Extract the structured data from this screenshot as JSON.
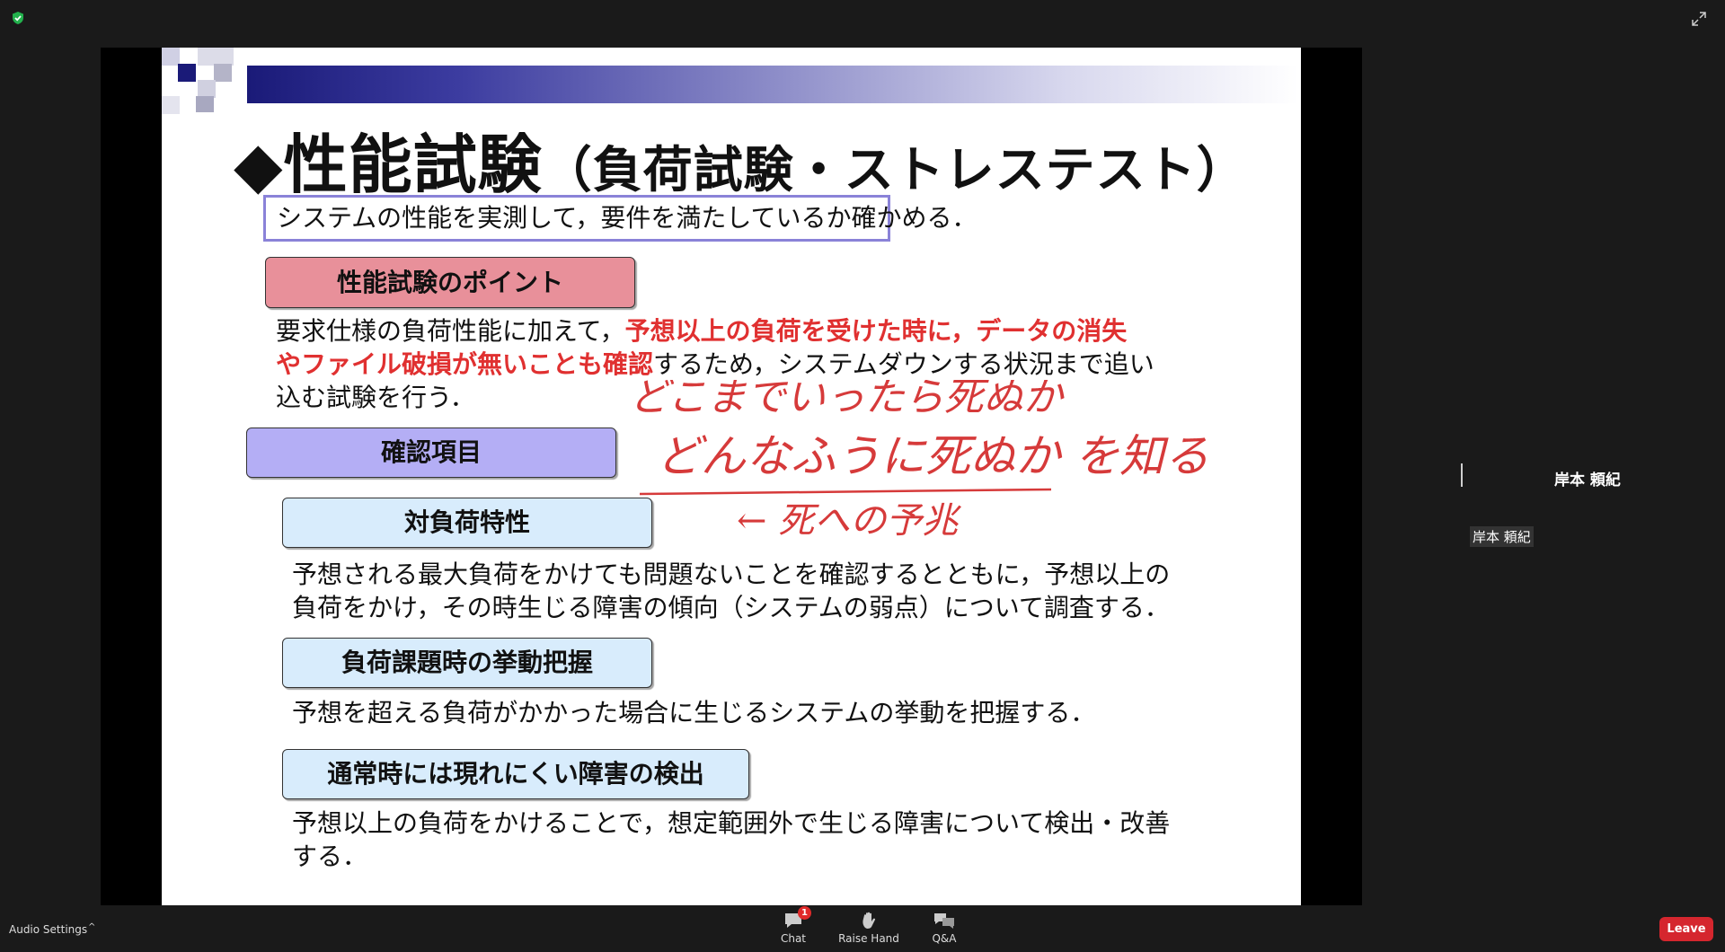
{
  "slide": {
    "title_main": "◆性能試験",
    "title_sub": "（負荷試験・ストレステスト）",
    "summary": "システムの性能を実測して，要件を満たしているか確かめる．",
    "point_heading": "性能試験のポイント",
    "point_text": {
      "line1_black": "要求仕様の負荷性能に加えて，",
      "line1_red": "予想以上の負荷を受けた時に，データの消失",
      "line2_red": "やファイル破損が無いことも確認",
      "line2_black": "するため，システムダウンする状況まで追い",
      "line3_black": "込む試験を行う．"
    },
    "check_heading": "確認項目",
    "items": [
      {
        "label": "対負荷特性",
        "line1": "予想される最大負荷をかけても問題ないことを確認するとともに，予想以上の",
        "line2": "負荷をかけ，その時生じる障害の傾向（システムの弱点）について調査する．"
      },
      {
        "label": "負荷課題時の挙動把握",
        "line1": "予想を超える負荷がかかった場合に生じるシステムの挙動を把握する．",
        "line2": ""
      },
      {
        "label": "通常時には現れにくい障害の検出",
        "line1": "予想以上の負荷をかけることで，想定範囲外で生じる障害について検出・改善",
        "line2": "する．"
      }
    ],
    "handwriting": {
      "line1": "どこまでいったら死ぬか",
      "line2": "どんなふうに死ぬか を知る",
      "line3": "← 死への予兆"
    }
  },
  "participant": {
    "name": "岸本 頼紀",
    "tag": "岸本 頼紀"
  },
  "controls": {
    "audio_settings": "Audio Settings",
    "chat": "Chat",
    "chat_badge": "1",
    "raise_hand": "Raise Hand",
    "qa": "Q&A",
    "leave": "Leave"
  },
  "colors": {
    "leave": "#d5262e",
    "slide_red_text": "#e03030",
    "handwriting": "#d63a3a",
    "pink_box": "#e8909a",
    "purple_box": "#b4aef5",
    "lightblue_box": "#d8ecfc"
  },
  "icons": [
    "shield-check-icon",
    "fullscreen-icon",
    "chat-icon",
    "raise-hand-icon",
    "qa-icon",
    "caret-up-icon"
  ]
}
